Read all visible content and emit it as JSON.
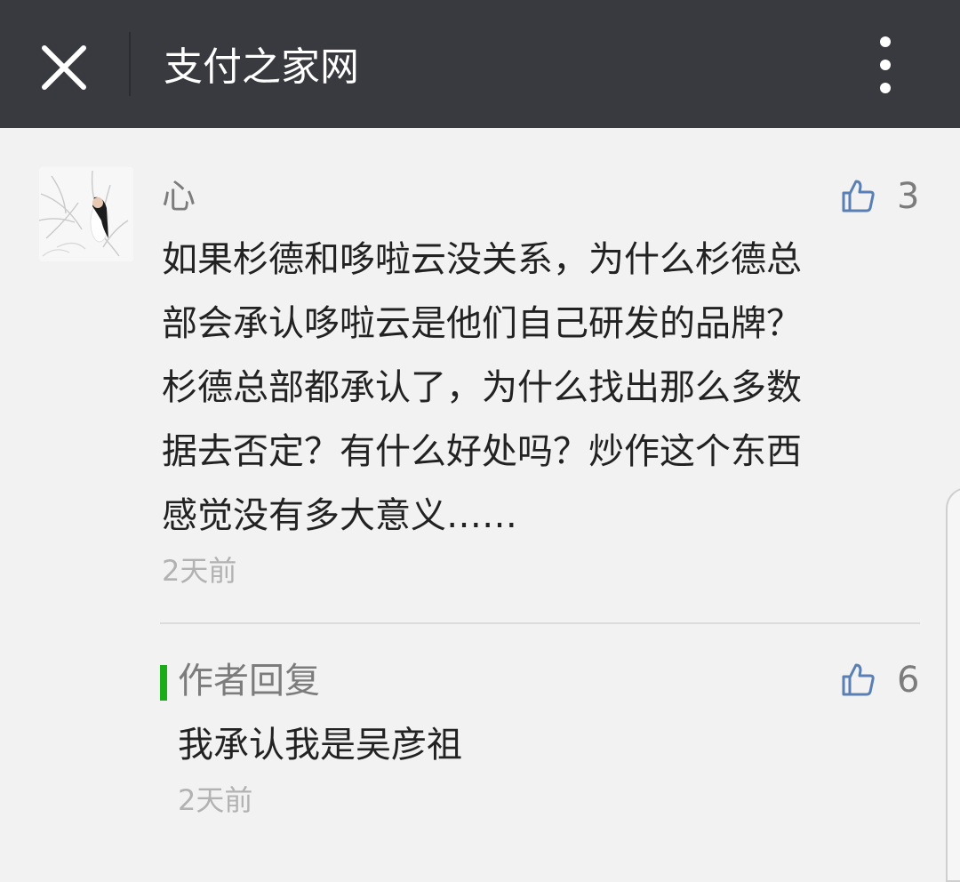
{
  "topbar": {
    "title": "支付之家网",
    "close_icon": "close-icon",
    "more_icon": "more-vertical-icon",
    "background": "#393a3f"
  },
  "comment": {
    "avatar_icon": "user-avatar-photo",
    "nickname": "心",
    "likes": "3",
    "lines": [
      "如果杉德和哆啦云没关系，为什么杉德总",
      "部会承认哆啦云是他们自己研发的品牌？",
      "杉德总部都承认了，为什么找出那么多数",
      "据去否定？有什么好处吗？炒作这个东西",
      "感觉没有多大意义……"
    ],
    "time": "2天前"
  },
  "reply": {
    "label": "作者回复",
    "likes": "6",
    "text": "我承认我是吴彦祖",
    "time": "2天前",
    "accent": "#1aad19"
  },
  "like_icon": "thumbs-up-icon",
  "like_color": "#5a7fb5"
}
